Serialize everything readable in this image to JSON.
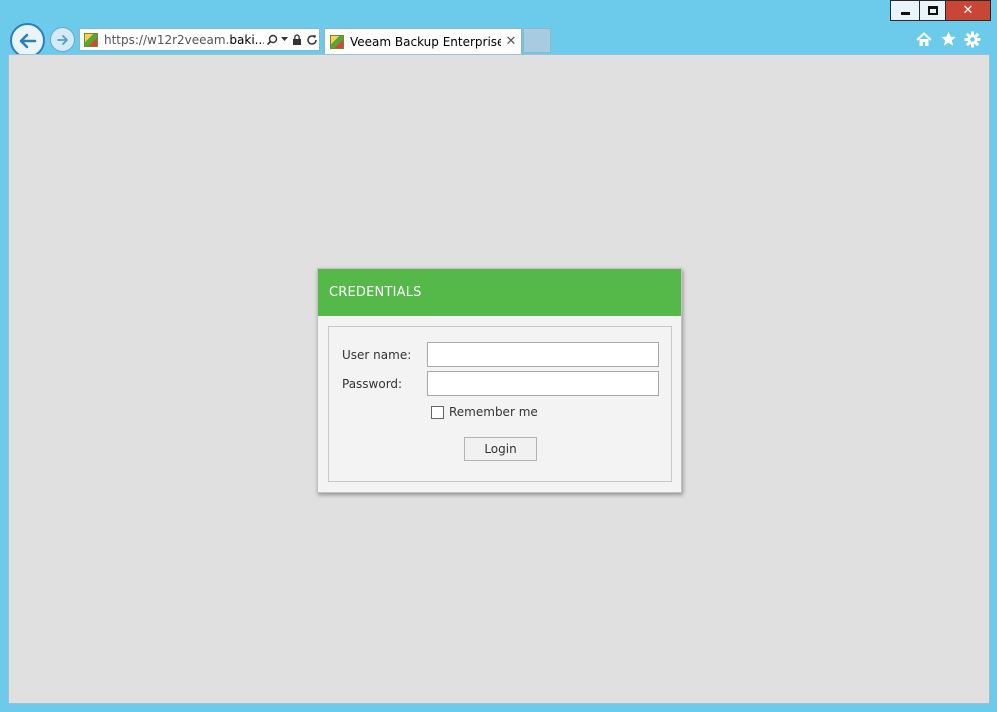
{
  "browser": {
    "address": {
      "url_prefix": "https://",
      "url_host_dim": "w12r2veeam.",
      "url_host_strong": "baki..."
    },
    "tab": {
      "title": "Veeam Backup Enterprise ...",
      "close_glyph": "✕"
    },
    "window_controls": {
      "close_glyph": "✕"
    }
  },
  "dialog": {
    "header": "CREDENTIALS",
    "username_label": "User name:",
    "username_value": "",
    "password_label": "Password:",
    "password_value": "",
    "remember_label": "Remember me",
    "remember_checked": false,
    "login_label": "Login"
  },
  "colors": {
    "header_green": "#54b948",
    "window_frame": "#6ccaeb",
    "close_red": "#c94536"
  }
}
